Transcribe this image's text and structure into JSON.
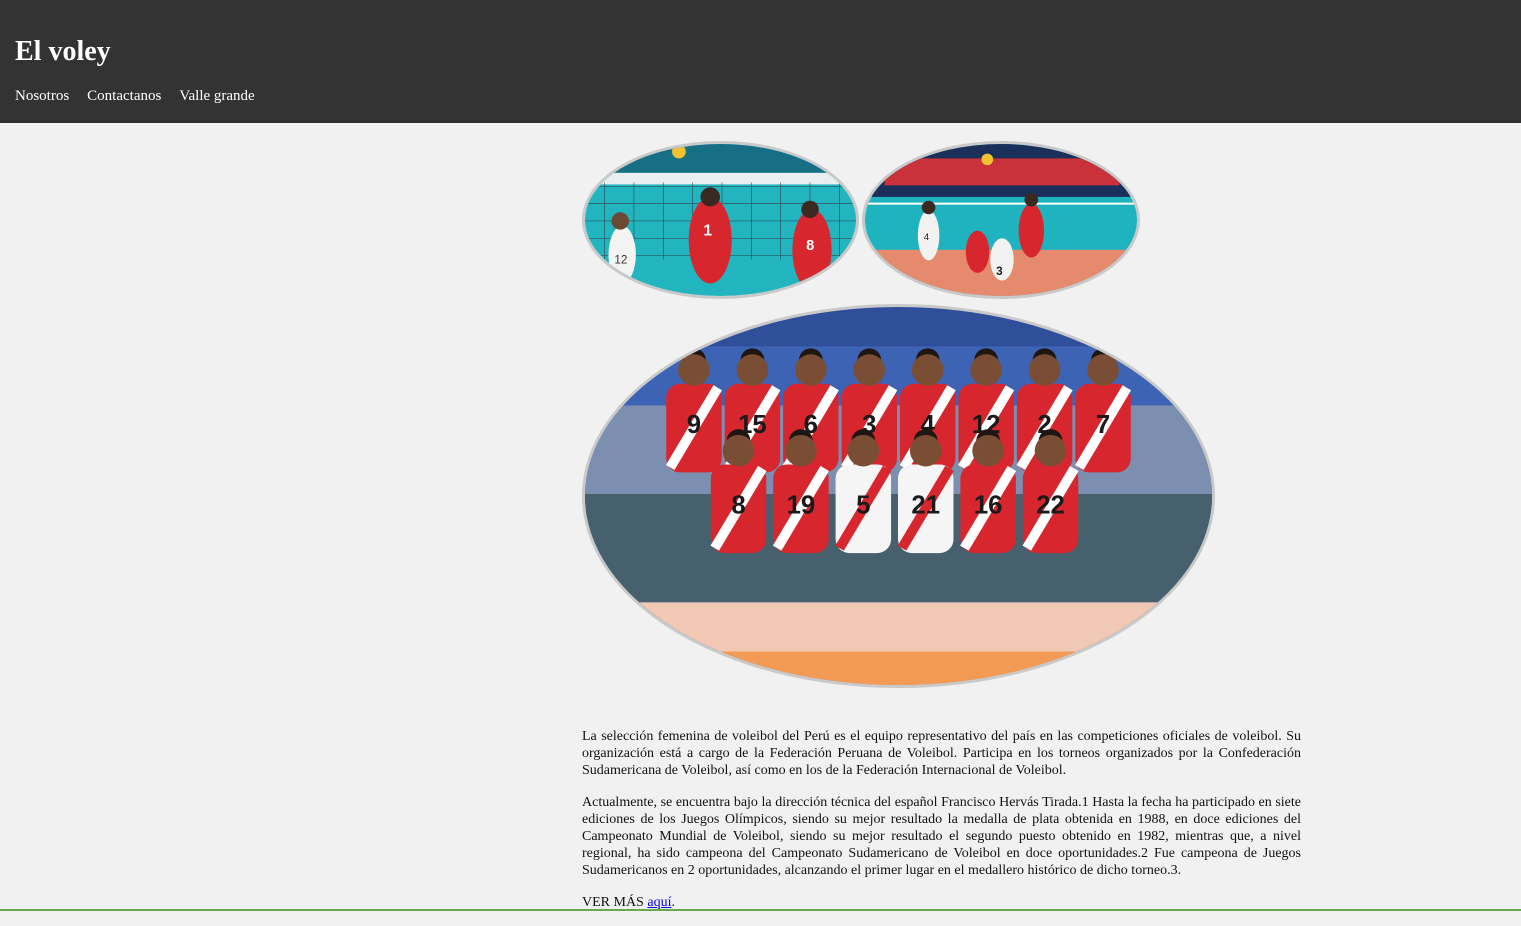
{
  "header": {
    "title": "El voley",
    "nav": [
      "Nosotros",
      "Contactanos",
      "Valle grande"
    ]
  },
  "article": {
    "paragraphs": [
      "La selección femenina de voleibol del Perú es el equipo representativo del país en las competiciones oficiales de voleibol. Su organización está a cargo de la Federación Peruana de Voleibol. Participa en los torneos organizados por la Confederación Sudamericana de Voleibol, así como en los de la Federación Internacional de Voleibol.",
      "Actualmente, se encuentra bajo la dirección técnica del español Francisco Hervás Tirada.1 Hasta la fecha ha participado en siete ediciones de los Juegos Olímpicos, siendo su mejor resultado la medalla de plata obtenida en 1988, en doce ediciones del Campeonato Mundial de Voleibol, siendo su mejor resultado el segundo puesto obtenido en 1982, mientras que, a nivel regional, ha sido campeona del Campeonato Sudamericano de Voleibol en doce oportunidades.2 Fue campeona de Juegos Sudamericanos en 2 oportunidades, alcanzando el primer lugar en el medallero histórico de dicho torneo.3."
    ],
    "more_prefix": "VER MÁS ",
    "more_link": "aquí",
    "more_suffix": "."
  },
  "photos": {
    "team_numbers_back": [
      "9",
      "15",
      "6",
      "3",
      "4",
      "12",
      "2",
      "7"
    ],
    "team_numbers_front": [
      "8",
      "19",
      "5",
      "21",
      "16",
      "22"
    ],
    "net_player_numbers": [
      "12",
      "1",
      "8"
    ],
    "match_player_numbers": [
      "4",
      "3"
    ]
  },
  "colors": {
    "header_bg": "#333333",
    "page_bg": "#f1f1f1",
    "jersey_red": "#d8262f",
    "court_teal": "#1fb3c0",
    "link": "#0000ee"
  }
}
